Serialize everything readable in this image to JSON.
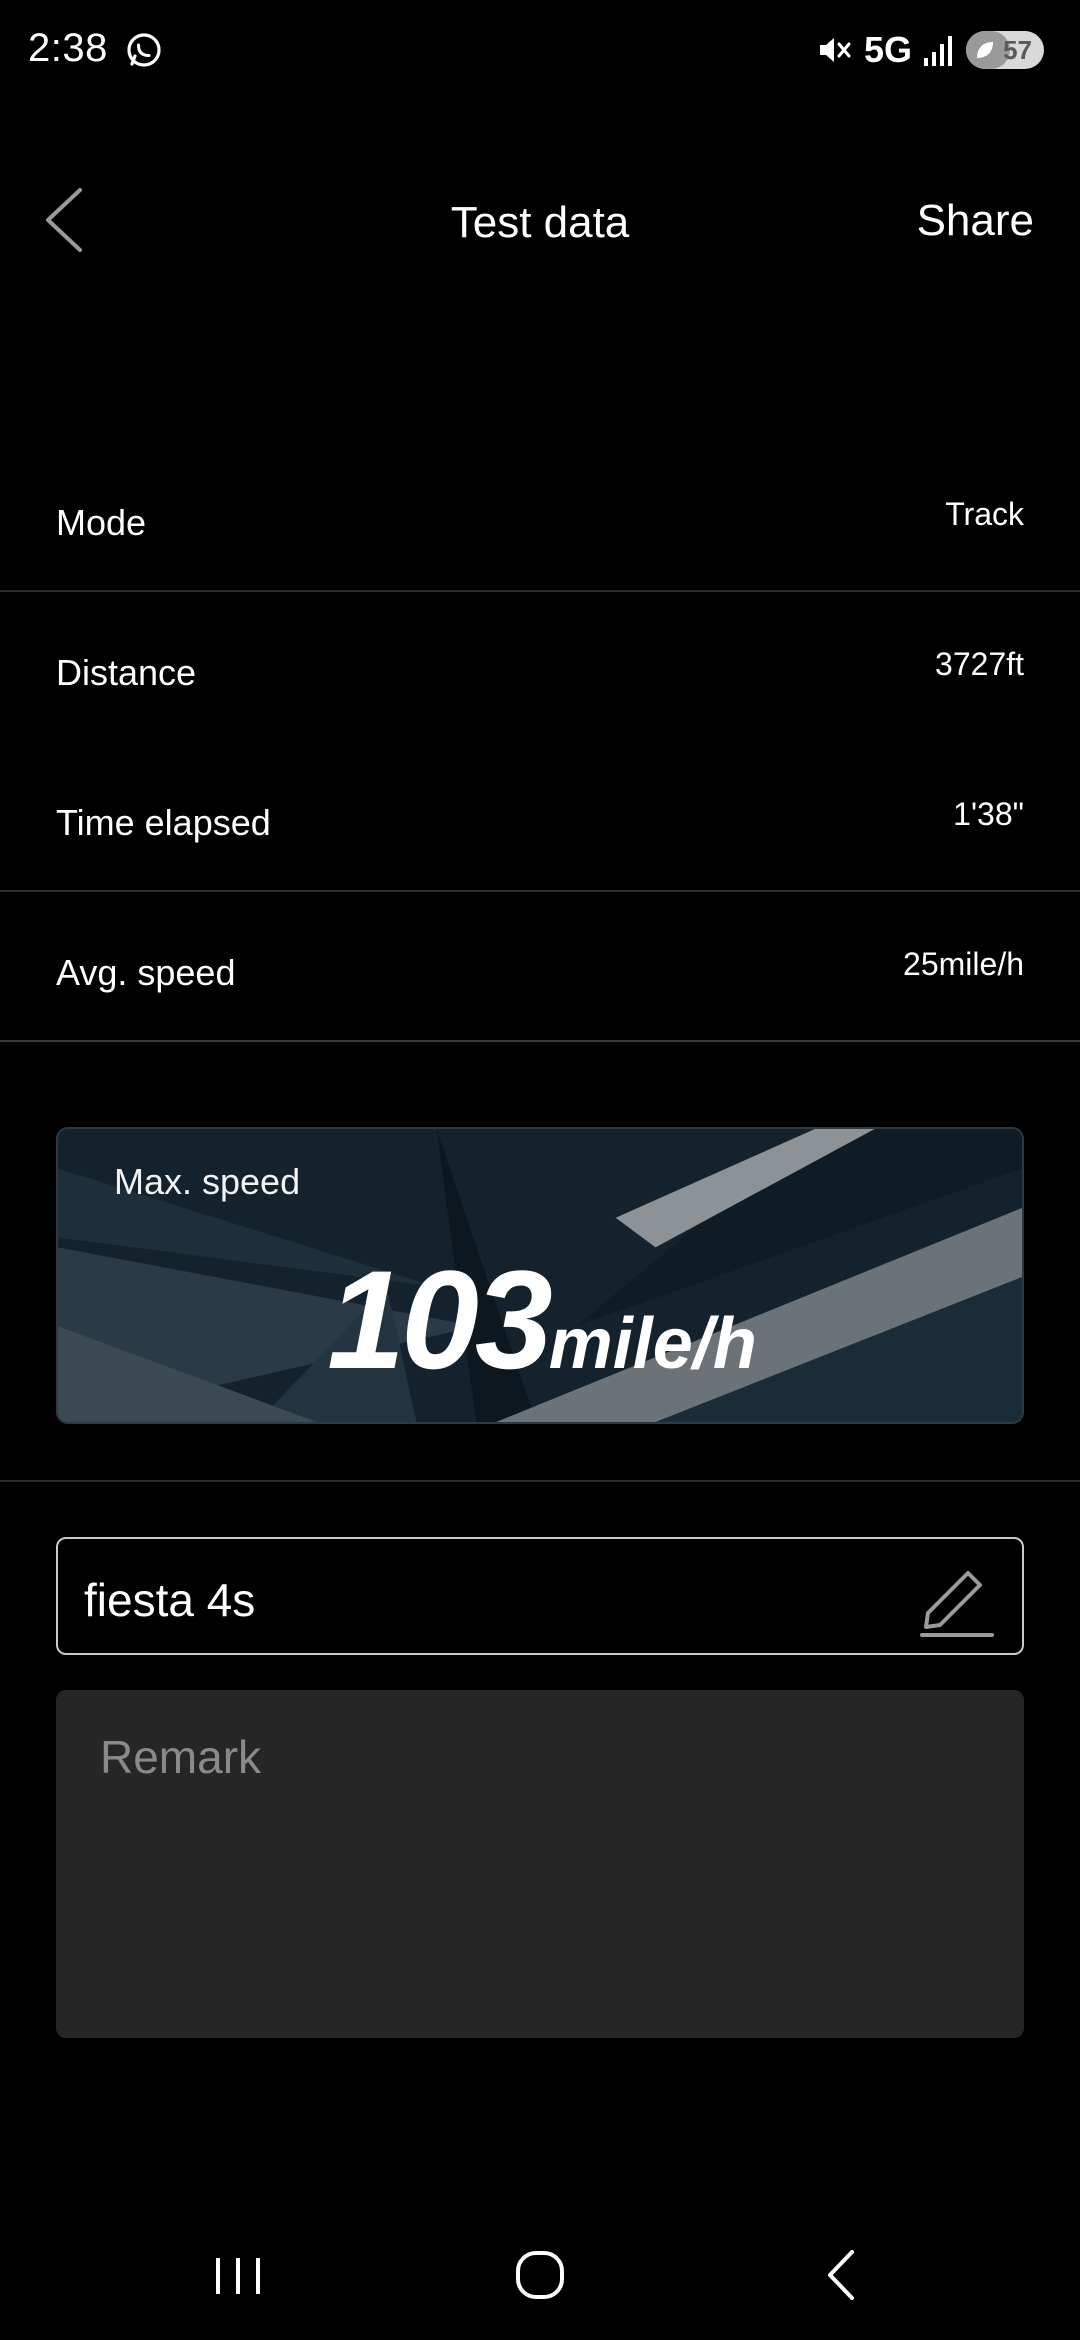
{
  "status_bar": {
    "time": "2:38",
    "network": "5G",
    "battery_level": "57",
    "icons": [
      "whatsapp-icon",
      "mute-icon",
      "signal-icon",
      "battery-icon"
    ]
  },
  "header": {
    "title": "Test data",
    "share_label": "Share",
    "back_icon": "chevron-left-icon"
  },
  "rows": [
    {
      "label": "Mode",
      "value": "Track"
    },
    {
      "label": "Distance",
      "value": "3727ft"
    },
    {
      "label": "Time elapsed",
      "value": "1'38\""
    },
    {
      "label": "Avg. speed",
      "value": "25mile/h"
    }
  ],
  "max_speed": {
    "label": "Max. speed",
    "value": "103",
    "unit": "mile/h"
  },
  "name_field": {
    "value": "fiesta 4s",
    "icon": "edit-pencil-icon"
  },
  "remark": {
    "placeholder": "Remark"
  },
  "nav_bar": {
    "icons": [
      "recents-icon",
      "home-icon",
      "back-icon"
    ]
  },
  "colors": {
    "background": "#000000",
    "divider": "#2b2b2b",
    "card_bg": "#142430",
    "remark_bg": "#262626",
    "placeholder": "#8a8a8a"
  }
}
